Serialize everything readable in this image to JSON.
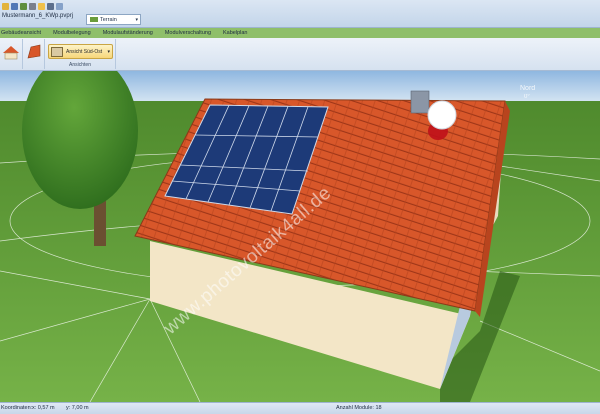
{
  "title": "Mustermann_6_KWp.pvprj",
  "terrain_select": "Terrain",
  "tabs": [
    "Gebäudeansicht",
    "Modulbelegung",
    "Modulaufständerung",
    "Modulverschaltung",
    "Kabelplan"
  ],
  "ribbon": {
    "view_button": "Ansicht Süd-Ost",
    "group_caption": "Ansichten"
  },
  "compass": {
    "north": "Nord",
    "label2": "0°"
  },
  "watermark": "www.photovoltaik4all.de",
  "status": {
    "coordinates_label": "Koordinaten:",
    "x": "x: 0,57 m",
    "y": "y: 7,00 m",
    "module_count": "Anzahl Module: 18"
  },
  "colors": {
    "roof": "#d8572a",
    "wall": "#f3e6c7",
    "grass": "#6aa03c",
    "sky": "#b7d2ec",
    "panel": "#1d3a78"
  },
  "icons": [
    "save-icon",
    "undo-icon",
    "redo-icon",
    "print-icon",
    "help-icon",
    "house-icon",
    "roof-icon"
  ]
}
